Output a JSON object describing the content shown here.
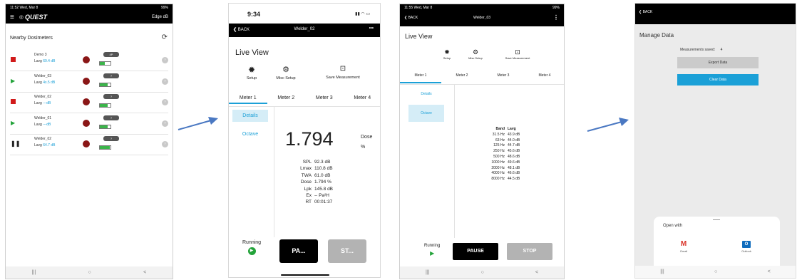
{
  "s1": {
    "status_time": "11:52",
    "status_date": "Wed, Mar 8",
    "status_battery": "99%",
    "app_logo": "QUEST",
    "edit_label": "Edge dB",
    "section_title": "Nearby Dosimeters",
    "rows": [
      {
        "name": "Demo 3",
        "lavg_label": "Lavg",
        "lavg_value": "69.4 dB",
        "status": "stopped",
        "badge": "4P",
        "battery": 0.45
      },
      {
        "name": "Welder_03",
        "lavg_label": "Lavg",
        "lavg_value": "4x.5 dB",
        "status": "running",
        "badge": "?",
        "battery": 0.7
      },
      {
        "name": "Welder_02",
        "lavg_label": "Lavg",
        "lavg_value": "---dB",
        "status": "stopped",
        "badge": "?",
        "battery": 0.7
      },
      {
        "name": "Welder_01",
        "lavg_label": "Lavg",
        "lavg_value": "---dB",
        "status": "running",
        "badge": "?",
        "battery": 0.7
      },
      {
        "name": "Welder_02",
        "lavg_label": "Lavg",
        "lavg_value": "64.7 dB",
        "status": "paused",
        "badge": "?",
        "battery": 0.9
      }
    ],
    "nav": [
      "|||",
      "○",
      "<"
    ]
  },
  "s2": {
    "time": "9:34",
    "back": "BACK",
    "title": "Welder_02",
    "more": "•••",
    "heading": "Live View",
    "actions": [
      "Setup",
      "Misc Setup",
      "Save Measurement"
    ],
    "tabs": [
      "Meter 1",
      "Meter 2",
      "Meter 3",
      "Meter 4"
    ],
    "side": [
      "Details",
      "Octave"
    ],
    "big_value": "1.794",
    "big_unit_top": "Dose",
    "big_unit_bottom": "%",
    "stats": [
      {
        "k": "SPL",
        "v": "92.3 dB"
      },
      {
        "k": "Lmax",
        "v": "110.8 dB"
      },
      {
        "k": "TWA",
        "v": "61.0 dB"
      },
      {
        "k": "Dose",
        "v": "1.794 %"
      },
      {
        "k": "Lpk",
        "v": "145.8 dB"
      },
      {
        "k": "Ex",
        "v": "-- Pa²H"
      },
      {
        "k": "RT",
        "v": "00:01:37"
      }
    ],
    "running": "Running",
    "pause": "PA...",
    "stop": "ST..."
  },
  "s3": {
    "status_time": "11:55",
    "status_date": "Wed, Mar 8",
    "status_battery": "99%",
    "back": "BACK",
    "title": "Welder_03",
    "more": "⋮",
    "heading": "Live View",
    "actions": [
      "Setup",
      "Misc Setup",
      "Save Measurement"
    ],
    "tabs": [
      "Meter 1",
      "Meter 2",
      "Meter 3",
      "Meter 4"
    ],
    "side": [
      "Details",
      "Octave"
    ],
    "col_band": "Band",
    "col_lavg": "Lavg",
    "bands": [
      {
        "band": "31.5 Hz",
        "lavg": "43.9 dB"
      },
      {
        "band": "63 Hz",
        "lavg": "44.0 dB"
      },
      {
        "band": "125 Hz",
        "lavg": "44.7 dB"
      },
      {
        "band": "250 Hz",
        "lavg": "45.6 dB"
      },
      {
        "band": "500 Hz",
        "lavg": "48.6 dB"
      },
      {
        "band": "1000 Hz",
        "lavg": "49.6 dB"
      },
      {
        "band": "2000 Hz",
        "lavg": "48.1 dB"
      },
      {
        "band": "4000 Hz",
        "lavg": "46.6 dB"
      },
      {
        "band": "8000 Hz",
        "lavg": "44.5 dB"
      }
    ],
    "running": "Running",
    "pause": "PAUSE",
    "stop": "STOP",
    "nav": [
      "|||",
      "○",
      "<"
    ]
  },
  "s4": {
    "back": "BACK",
    "heading": "Manage Data",
    "saved_label": "Measurements saved:",
    "saved_count": "4",
    "export": "Export Data",
    "clear": "Clear Data",
    "open_with": "Open with",
    "apps": [
      "Gmail",
      "Outlook"
    ],
    "nav": [
      "|||",
      "○",
      "<"
    ]
  },
  "colors": {
    "accent": "#1ba0d7",
    "arrow": "#4a78c2",
    "record": "#d11a1a",
    "run": "#23a33a"
  }
}
